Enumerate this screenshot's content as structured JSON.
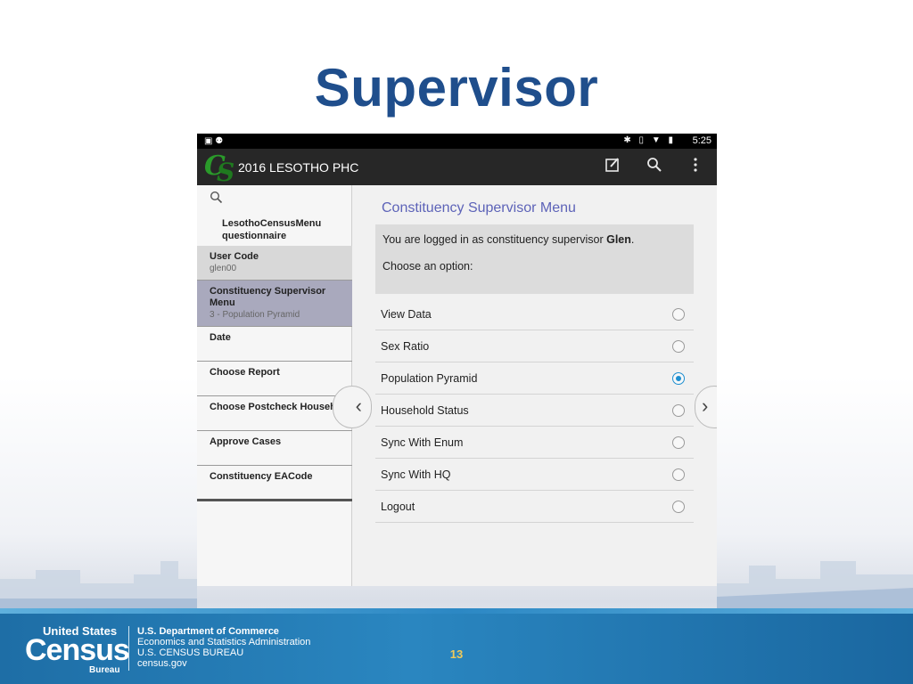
{
  "slide": {
    "title": "Supervisor",
    "page_number": "13"
  },
  "footer": {
    "logo_united_states": "United States",
    "logo_census": "Census",
    "logo_bureau": "Bureau",
    "dept": "U.S. Department of Commerce",
    "esa": "Economics and Statistics Administration",
    "bureau": "U.S. CENSUS BUREAU",
    "site": "census.gov"
  },
  "status_bar": {
    "time": "5:25",
    "left_icons": [
      "image-icon",
      "android-icon"
    ],
    "right_icons": [
      "bluetooth-icon",
      "vibrate-icon",
      "wifi-icon",
      "battery-icon"
    ]
  },
  "action_bar": {
    "app_title": "2016 LESOTHO PHC",
    "icons": [
      "edit-icon",
      "search-icon",
      "overflow-menu-icon"
    ]
  },
  "sidebar": {
    "header": "LesothoCensusMenu questionnaire",
    "items": [
      {
        "label": "User Code",
        "value": "glen00"
      },
      {
        "label": "Constituency Supervisor Menu",
        "value": "3 - Population Pyramid"
      },
      {
        "label": "Date",
        "value": ""
      },
      {
        "label": "Choose Report",
        "value": ""
      },
      {
        "label": "Choose Postcheck Household",
        "value": ""
      },
      {
        "label": "Approve Cases",
        "value": ""
      },
      {
        "label": "Constituency EACode",
        "value": ""
      }
    ]
  },
  "content": {
    "menu_title": "Constituency Supervisor Menu",
    "login_prefix": "You are logged in as constituency supervisor ",
    "login_name": "Glen",
    "login_suffix": ".",
    "prompt": "Choose an option:",
    "options": [
      {
        "label": "View Data",
        "selected": false
      },
      {
        "label": "Sex Ratio",
        "selected": false
      },
      {
        "label": "Population Pyramid",
        "selected": true
      },
      {
        "label": "Household Status",
        "selected": false
      },
      {
        "label": "Sync With Enum",
        "selected": false
      },
      {
        "label": "Sync With HQ",
        "selected": false
      },
      {
        "label": "Logout",
        "selected": false
      }
    ]
  },
  "colors": {
    "title": "#1f4e8c",
    "accent": "#1e8fd0",
    "menu_title": "#5d63b8",
    "footer_blue": "#2a86c0"
  }
}
